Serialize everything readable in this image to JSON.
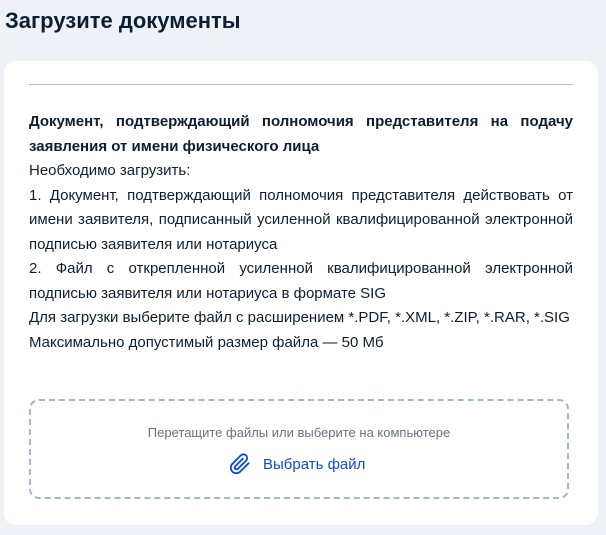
{
  "page": {
    "title": "Загрузите документы"
  },
  "document": {
    "title": "Документ, подтверждающий полномочия представителя на подачу заявления от имени физического лица",
    "lines": [
      "Необходимо загрузить:",
      "1. Документ, подтверждающий полномочия представителя действовать от имени заявителя, подписанный усиленной квалифицированной электронной подписью заявителя или нотариуса",
      "2. Файл с открепленной усиленной квалифицированной электронной подписью заявителя или нотариуса в формате SIG",
      "Для загрузки выберите файл с расширением *.PDF, *.XML, *.ZIP, *.RAR, *.SIG",
      "Максимально допустимый размер файла — 50 Мб"
    ]
  },
  "upload": {
    "hint": "Перетащите файлы или выберите на компьютере",
    "button_label": "Выбрать файл",
    "button_icon": "paperclip-icon"
  },
  "colors": {
    "background": "#eef1f6",
    "card": "#ffffff",
    "text": "#0b1f33",
    "accent": "#0d4cd3",
    "muted": "#66727f",
    "dashed_border": "#9fb6d4"
  }
}
